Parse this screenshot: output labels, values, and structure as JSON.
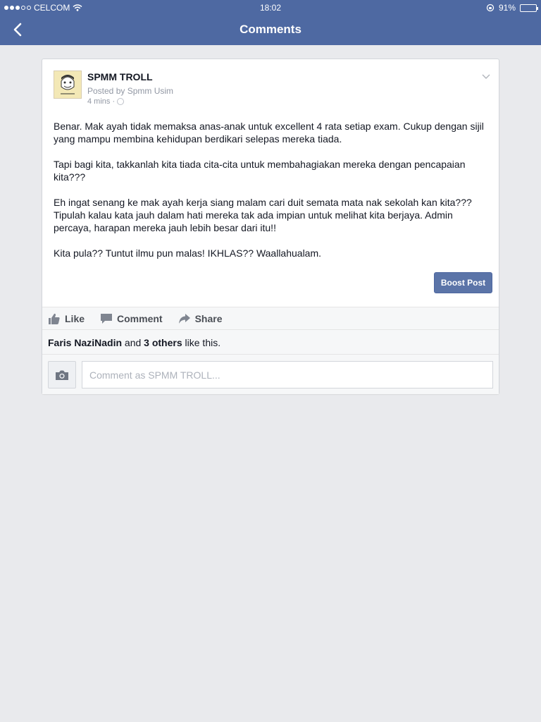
{
  "status_bar": {
    "carrier": "CELCOM",
    "time": "18:02",
    "battery": "91%"
  },
  "nav": {
    "title": "Comments"
  },
  "post": {
    "page_name": "SPMM TROLL",
    "posted_by_prefix": "Posted by ",
    "posted_by_name": "Spmm Usim",
    "time_ago": "4 mins ·",
    "paragraphs": [
      "Benar. Mak ayah tidak memaksa anas-anak untuk excellent 4 rata setiap exam. Cukup dengan sijil yang mampu membina kehidupan berdikari selepas mereka tiada.",
      "Tapi bagi kita, takkanlah kita tiada cita-cita untuk membahagiakan mereka dengan pencapaian kita???",
      "Eh ingat senang ke mak ayah kerja siang malam cari duit semata mata nak sekolah kan kita??? Tipulah kalau kata jauh dalam hati mereka tak ada impian untuk melihat kita berjaya. Admin percaya, harapan mereka jauh lebih besar dari itu!!",
      "Kita pula?? Tuntut ilmu pun malas! IKHLAS?? Waallahualam."
    ],
    "boost_label": "Boost Post"
  },
  "actions": {
    "like": "Like",
    "comment": "Comment",
    "share": "Share"
  },
  "likes": {
    "liker": "Faris NaziNadin",
    "middle": " and ",
    "others": "3 others",
    "suffix": " like this."
  },
  "comment_box": {
    "placeholder": "Comment as SPMM TROLL..."
  },
  "colors": {
    "header": "#4e69a2",
    "background": "#e9eaed",
    "boost_button": "#5b74a8"
  }
}
